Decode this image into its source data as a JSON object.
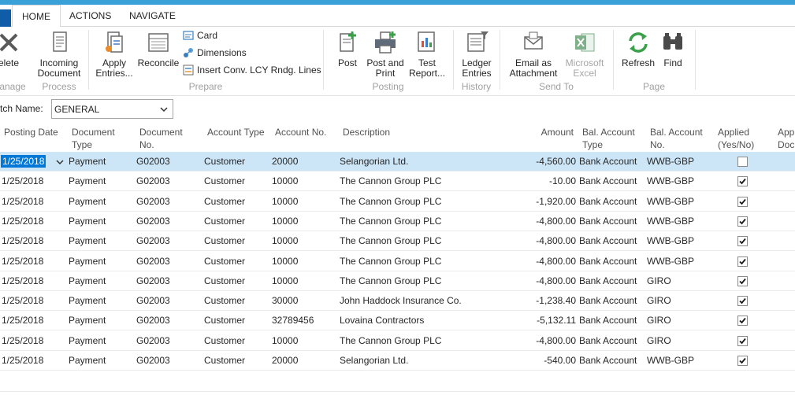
{
  "tabs": [
    {
      "label": "HOME"
    },
    {
      "label": "ACTIONS"
    },
    {
      "label": "NAVIGATE"
    }
  ],
  "ribbon": {
    "delete_label": "elete",
    "incoming_document_label": "Incoming\nDocument",
    "apply_entries_label": "Apply\nEntries...",
    "reconcile_label": "Reconcile",
    "card_label": "Card",
    "dimensions_label": "Dimensions",
    "insert_conv_label": "Insert Conv. LCY Rndg. Lines",
    "post_label": "Post",
    "post_and_print_label": "Post and\nPrint",
    "test_report_label": "Test\nReport...",
    "ledger_entries_label": "Ledger\nEntries",
    "email_attachment_label": "Email as\nAttachment",
    "microsoft_excel_label": "Microsoft\nExcel",
    "refresh_label": "Refresh",
    "find_label": "Find",
    "groups": {
      "manage": "anage",
      "process": "Process",
      "prepare": "Prepare",
      "posting": "Posting",
      "history": "History",
      "send_to": "Send To",
      "page": "Page"
    }
  },
  "batch": {
    "label": "tch Name:",
    "value": "GENERAL"
  },
  "columns": {
    "posting_date": "Posting Date",
    "document_type": "Document\nType",
    "document_no": "Document\nNo.",
    "account_type": "Account Type",
    "account_no": "Account No.",
    "description": "Description",
    "amount": "Amount",
    "bal_account_type": "Bal. Account\nType",
    "bal_account_no": "Bal. Account\nNo.",
    "applied": "Applied\n(Yes/No)",
    "applies_to_doc": "App\nDoc"
  },
  "rows": [
    {
      "date": "1/25/2018",
      "doc_type": "Payment",
      "doc_no": "G02003",
      "acc_type": "Customer",
      "acc_no": "20000",
      "desc": "Selangorian Ltd.",
      "amount": "-4,560.00",
      "bal_type": "Bank Account",
      "bal_no": "WWB-GBP",
      "applied": false
    },
    {
      "date": "1/25/2018",
      "doc_type": "Payment",
      "doc_no": "G02003",
      "acc_type": "Customer",
      "acc_no": "10000",
      "desc": "The Cannon Group PLC",
      "amount": "-10.00",
      "bal_type": "Bank Account",
      "bal_no": "WWB-GBP",
      "applied": true
    },
    {
      "date": "1/25/2018",
      "doc_type": "Payment",
      "doc_no": "G02003",
      "acc_type": "Customer",
      "acc_no": "10000",
      "desc": "The Cannon Group PLC",
      "amount": "-1,920.00",
      "bal_type": "Bank Account",
      "bal_no": "WWB-GBP",
      "applied": true
    },
    {
      "date": "1/25/2018",
      "doc_type": "Payment",
      "doc_no": "G02003",
      "acc_type": "Customer",
      "acc_no": "10000",
      "desc": "The Cannon Group PLC",
      "amount": "-4,800.00",
      "bal_type": "Bank Account",
      "bal_no": "WWB-GBP",
      "applied": true
    },
    {
      "date": "1/25/2018",
      "doc_type": "Payment",
      "doc_no": "G02003",
      "acc_type": "Customer",
      "acc_no": "10000",
      "desc": "The Cannon Group PLC",
      "amount": "-4,800.00",
      "bal_type": "Bank Account",
      "bal_no": "WWB-GBP",
      "applied": true
    },
    {
      "date": "1/25/2018",
      "doc_type": "Payment",
      "doc_no": "G02003",
      "acc_type": "Customer",
      "acc_no": "10000",
      "desc": "The Cannon Group PLC",
      "amount": "-4,800.00",
      "bal_type": "Bank Account",
      "bal_no": "WWB-GBP",
      "applied": true
    },
    {
      "date": "1/25/2018",
      "doc_type": "Payment",
      "doc_no": "G02003",
      "acc_type": "Customer",
      "acc_no": "10000",
      "desc": "The Cannon Group PLC",
      "amount": "-4,800.00",
      "bal_type": "Bank Account",
      "bal_no": "GIRO",
      "applied": true
    },
    {
      "date": "1/25/2018",
      "doc_type": "Payment",
      "doc_no": "G02003",
      "acc_type": "Customer",
      "acc_no": "30000",
      "desc": "John Haddock Insurance Co.",
      "amount": "-1,238.40",
      "bal_type": "Bank Account",
      "bal_no": "GIRO",
      "applied": true
    },
    {
      "date": "1/25/2018",
      "doc_type": "Payment",
      "doc_no": "G02003",
      "acc_type": "Customer",
      "acc_no": "32789456",
      "desc": "Lovaina Contractors",
      "amount": "-5,132.11",
      "bal_type": "Bank Account",
      "bal_no": "GIRO",
      "applied": true
    },
    {
      "date": "1/25/2018",
      "doc_type": "Payment",
      "doc_no": "G02003",
      "acc_type": "Customer",
      "acc_no": "10000",
      "desc": "The Cannon Group PLC",
      "amount": "-4,800.00",
      "bal_type": "Bank Account",
      "bal_no": "GIRO",
      "applied": true
    },
    {
      "date": "1/25/2018",
      "doc_type": "Payment",
      "doc_no": "G02003",
      "acc_type": "Customer",
      "acc_no": "20000",
      "desc": "Selangorian Ltd.",
      "amount": "-540.00",
      "bal_type": "Bank Account",
      "bal_no": "WWB-GBP",
      "applied": true
    }
  ],
  "colors": {
    "accent": "#3aa0d8",
    "selected_row": "#cde6f7",
    "selected_cell": "#0078d7"
  }
}
